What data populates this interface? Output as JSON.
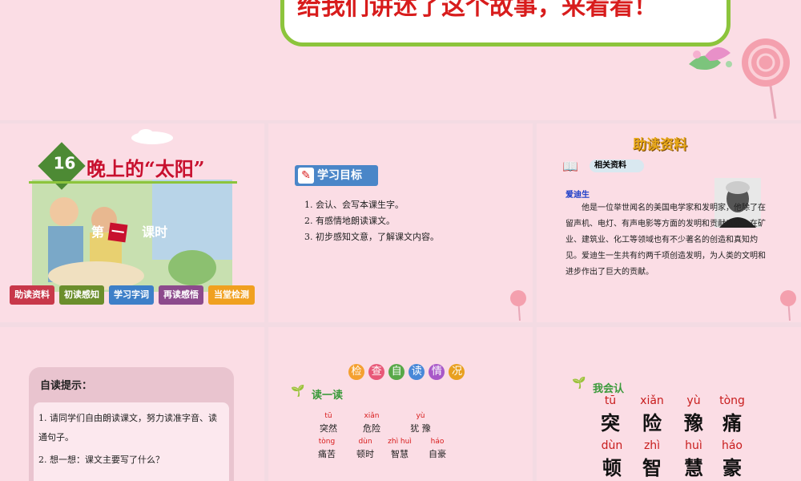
{
  "banner": {
    "text": "给我们讲述了这个故事，来看看！"
  },
  "slide1": {
    "lesson_number": "16",
    "title": "晚上的“太阳”",
    "period_prefix": "第",
    "period_num": "一",
    "period_suffix": "课时",
    "nav": [
      "助读资料",
      "初读感知",
      "学习字词",
      "再读感悟",
      "当堂检测"
    ],
    "nav_colors": [
      "#c8384a",
      "#6b8e2c",
      "#3d7fc8",
      "#8c4a8c",
      "#f0a020"
    ]
  },
  "slide2": {
    "tag": "学习目标",
    "goals": [
      "1. 会认、会写本课生字。",
      "2. 有感情地朗读课文。",
      "3. 初步感知文意，了解课文内容。"
    ]
  },
  "slide3": {
    "heading": "助读资料",
    "tag": "相关资料",
    "person": "爱迪生",
    "body": "他是一位举世闻名的美国电学家和发明家，他除了在留声机、电灯、有声电影等方面的发明和贡献以外，在矿业、建筑业、化工等领域也有不少著名的创造和真知灼见。爱迪生一生共有约两千项创造发明，为人类的文明和进步作出了巨大的贡献。"
  },
  "slide4": {
    "title": "自读提示：",
    "items": [
      "1. 请同学们自由朗读课文，努力读准字音、读通句子。",
      "2. 想一想：课文主要写了什么？"
    ]
  },
  "slide5": {
    "heading_chars": [
      "检",
      "查",
      "自",
      "读",
      "情",
      "况"
    ],
    "sub": "读一读",
    "row1": [
      {
        "py": "tū",
        "hz": "突然"
      },
      {
        "py": "xiǎn",
        "hz": "危险"
      },
      {
        "py": "yù",
        "hz": "犹 豫"
      }
    ],
    "row2": [
      {
        "py": "tòng",
        "hz": "痛苦"
      },
      {
        "py": "dùn",
        "hz": "顿时"
      },
      {
        "py": "zhì huì",
        "hz": "智慧"
      },
      {
        "py": "háo",
        "hz": "自豪"
      }
    ]
  },
  "slide6": {
    "sub": "我会认",
    "chars": [
      {
        "py": "tū",
        "hz": "突"
      },
      {
        "py": "xiǎn",
        "hz": "险"
      },
      {
        "py": "yù",
        "hz": "豫"
      },
      {
        "py": "tòng",
        "hz": "痛"
      },
      {
        "py": "dùn",
        "hz": "顿"
      },
      {
        "py": "zhì",
        "hz": "智"
      },
      {
        "py": "huì",
        "hz": "慧"
      },
      {
        "py": "háo",
        "hz": "豪"
      }
    ]
  }
}
